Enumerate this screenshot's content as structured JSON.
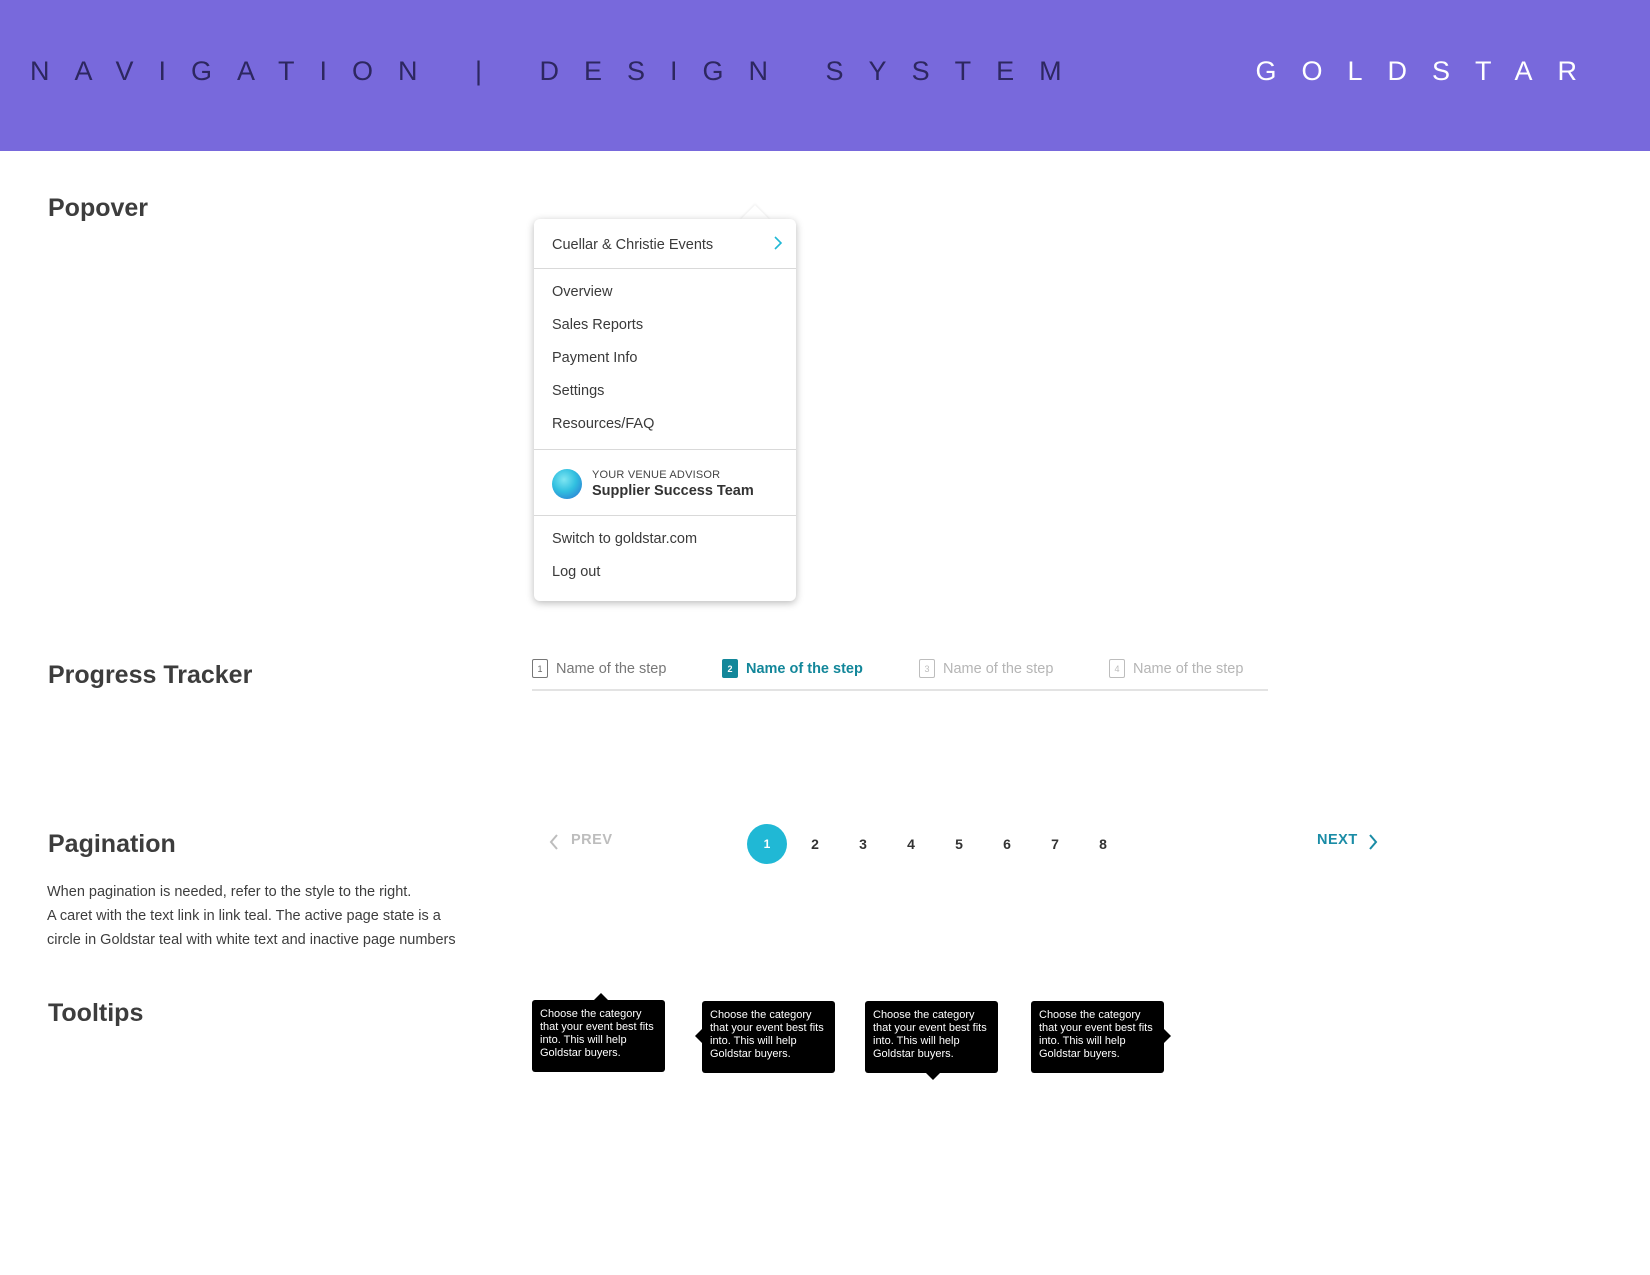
{
  "header": {
    "title": "NAVIGATION | DESIGN SYSTEM",
    "brand": "GOLDSTAR",
    "bg_color": "#7869dc"
  },
  "sections": {
    "popover": "Popover",
    "progress": "Progress Tracker",
    "pagination": "Pagination",
    "tooltips": "Tooltips"
  },
  "popover": {
    "account": "Cuellar & Christie Events",
    "account_icon": "chevron-right-icon",
    "items": [
      "Overview",
      "Sales Reports",
      "Payment Info",
      "Settings",
      "Resources/FAQ"
    ],
    "advisor_label": "YOUR VENUE ADVISOR",
    "advisor_name": "Supplier Success Team",
    "switch_link": "Switch to goldstar.com",
    "logout": "Log out"
  },
  "progress": {
    "steps": [
      {
        "num": "1",
        "label": "Name of the step",
        "state": "done"
      },
      {
        "num": "2",
        "label": "Name of the step",
        "state": "active"
      },
      {
        "num": "3",
        "label": "Name of the step",
        "state": "inactive"
      },
      {
        "num": "4",
        "label": "Name of the step",
        "state": "inactive"
      }
    ],
    "active_color": "#13879a"
  },
  "pagination": {
    "prev": "PREV",
    "next": "NEXT",
    "pages": [
      "1",
      "2",
      "3",
      "4",
      "5",
      "6",
      "7",
      "8"
    ],
    "current": "1",
    "active_color": "#20b8d5",
    "link_color": "#1a8ca6",
    "description": [
      "When pagination is needed, refer to the style to the right.",
      "A caret with the text link in link teal. The active page state is a",
      "circle in Goldstar teal with white text and inactive page numbers"
    ]
  },
  "tooltips": {
    "text": "Choose the category that your event best fits into. This will help Goldstar buyers.",
    "variants": [
      "arrow-top",
      "arrow-left",
      "arrow-bottom",
      "arrow-right"
    ]
  }
}
